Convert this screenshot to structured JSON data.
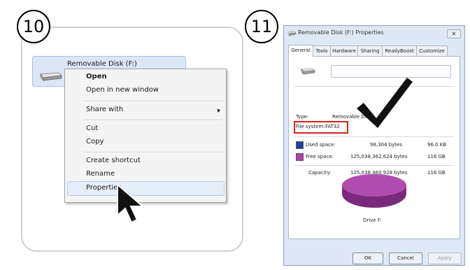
{
  "steps": {
    "left": "10",
    "right": "11"
  },
  "explorer": {
    "drive_label": "Removable Disk (F:)"
  },
  "context_menu": {
    "items": [
      "Open",
      "Open in new window",
      "Share with",
      "Cut",
      "Copy",
      "Create shortcut",
      "Rename",
      "Properties"
    ]
  },
  "dialog": {
    "title": "Removable Disk (F:) Properties",
    "close_glyph": "✕",
    "tabs": [
      "General",
      "Tools",
      "Hardware",
      "Sharing",
      "ReadyBoost",
      "Customize"
    ],
    "active_tab": "General",
    "type_label": "Type:",
    "type_value": "Removable Disk",
    "fs_label": "File system:",
    "fs_value": "FAT32",
    "used_label": "Used space:",
    "used_bytes": "98,304 bytes",
    "used_size": "96.0 KB",
    "free_label": "Free space:",
    "free_bytes": "125,038,362,624 bytes",
    "free_size": "116 GB",
    "capacity_label": "Capacity:",
    "capacity_bytes": "125,038,460,928 bytes",
    "capacity_size": "116 GB",
    "drive_caption": "Drive F:",
    "buttons": {
      "ok": "OK",
      "cancel": "Cancel",
      "apply": "Apply"
    }
  },
  "colors": {
    "used_swatch": "#1f3fa8",
    "free_swatch": "#b23fb0",
    "fs_highlight": "#e02020",
    "pie_top": "#b04cb0",
    "pie_side": "#7a2a7a"
  },
  "icons": [
    "drive-icon",
    "mouse-cursor-icon",
    "checkmark-icon",
    "close-icon"
  ]
}
